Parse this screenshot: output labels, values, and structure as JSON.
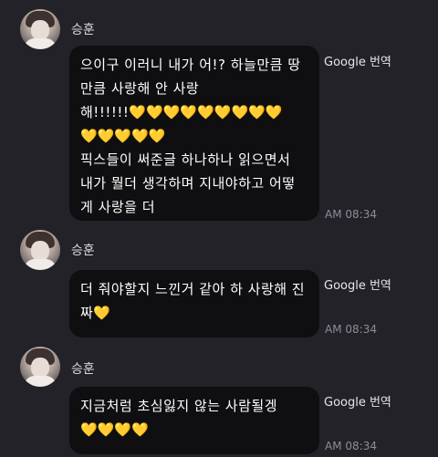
{
  "messages": [
    {
      "sender": "승훈",
      "lines": [
        "으이구 이러니 내가 어!? 하늘만큼 땅",
        "만큼 사랑해 안 사랑",
        "해!!!!!!",
        "",
        "픽스들이 써준글 하나하나 읽으면서",
        "내가 뭘더 생각하며 지내야하고 어떻",
        "게 사랑을 더"
      ],
      "hearts_line3": "💛💛💛💛💛💛💛💛💛",
      "hearts_line4": "💛💛💛💛💛",
      "translate_label": "Google 번역",
      "time": "AM 08:34"
    },
    {
      "sender": "승훈",
      "lines": [
        "더 줘야할지 느낀거 같아 하 사랑해 진",
        "짜"
      ],
      "hearts_line2": "💛",
      "translate_label": "Google 번역",
      "time": "AM 08:34"
    },
    {
      "sender": "승훈",
      "lines": [
        "지금처럼 초심잃지 않는 사람될겡",
        ""
      ],
      "hearts_line2": "💛💛💛💛",
      "translate_label": "Google 번역",
      "time": "AM 08:34"
    }
  ],
  "icons": {
    "avatar": "profile-photo",
    "heart": "yellow-heart"
  },
  "colors": {
    "background": "#222228",
    "bubble": "#0f0f12",
    "heart": "#f3c54e"
  }
}
